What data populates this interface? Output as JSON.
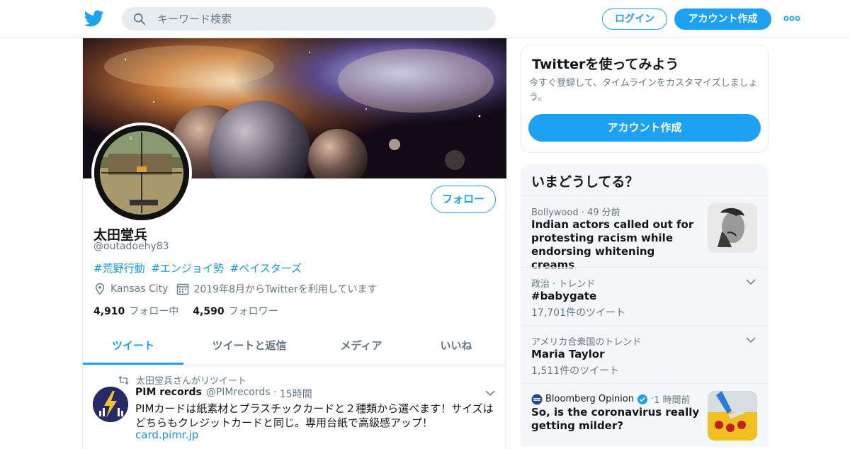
{
  "topbar": {
    "search_placeholder": "キーワード検索",
    "login_label": "ログイン",
    "signup_label": "アカウント作成"
  },
  "profile": {
    "name": "太田堂兵",
    "handle": "@outadoehy83",
    "bio_tags": [
      "#荒野行動",
      "#エンジョイ勢",
      "#ベイスターズ"
    ],
    "location": "Kansas City",
    "joined": "2019年8月からTwitterを利用しています",
    "following_count": "4,910",
    "following_label": "フォロー中",
    "followers_count": "4,590",
    "followers_label": "フォロワー",
    "follow_button": "フォロー"
  },
  "tabs": [
    "ツイート",
    "ツイートと返信",
    "メディア",
    "いいね"
  ],
  "tweet": {
    "retweet_note": "太田堂兵さんがリツイート",
    "author": "PIM records",
    "author_handle": "@PIMrecords",
    "time": "15時間",
    "text": "PIMカードは紙素材とプラスチックカードと２種類から選べます！サイズはどちらもクレジットカードと同じ。専用台紙で高級感アップ！",
    "link": "card.pimr.jp"
  },
  "signup_card": {
    "title": "Twitterを使ってみよう",
    "subtitle": "今すぐ登録して、タイムラインをカスタマイズしましょう。",
    "button": "アカウント作成"
  },
  "trends": {
    "title": "いまどうしてる？",
    "items": [
      {
        "context": "Bollywood",
        "time": "49 分前",
        "title": "Indian actors called out for protesting racism while endorsing whitening creams"
      },
      {
        "context": "政治 · トレンド",
        "title": "#babygate",
        "count": "17,701件のツイート"
      },
      {
        "context": "アメリカ合衆国のトレンド",
        "title": "Maria Taylor",
        "count": "1,511件のツイート"
      },
      {
        "context": "Bloomberg Opinion",
        "time": "1 時間前",
        "title": "So, is the coronavirus really getting milder?"
      }
    ]
  },
  "colors": {
    "accent": "#1da1f2",
    "link": "#1b95e0",
    "muted": "#657786",
    "border": "#e6ecf0"
  }
}
